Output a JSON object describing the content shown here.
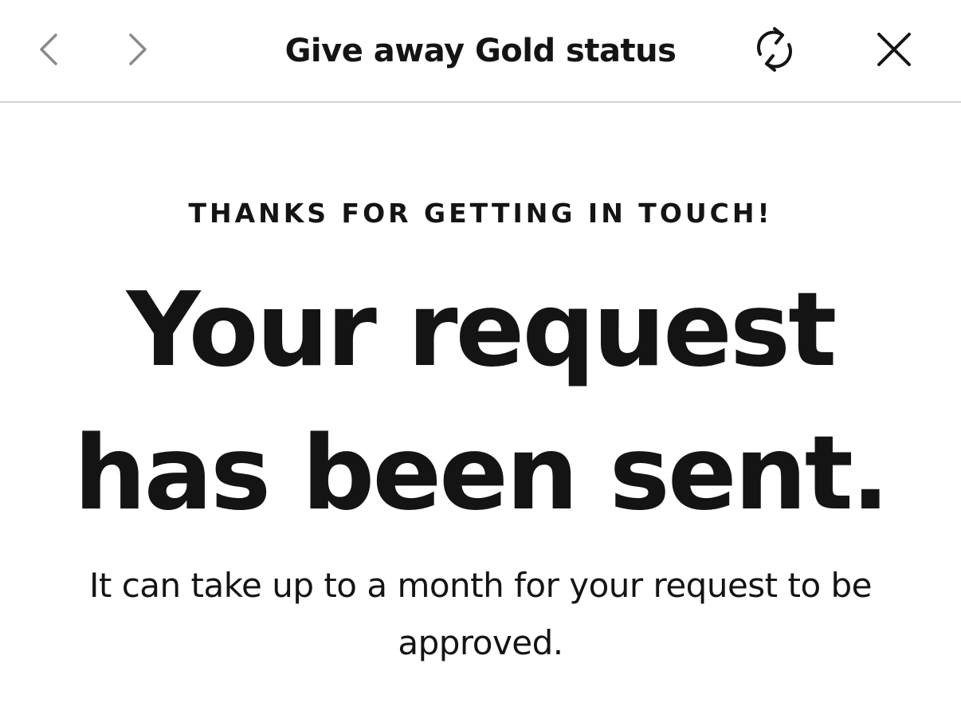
{
  "header": {
    "title": "Give away Gold status",
    "back_icon": "chevron-left-icon",
    "forward_icon": "chevron-right-icon",
    "refresh_icon": "refresh-icon",
    "close_icon": "close-icon"
  },
  "main": {
    "eyebrow": "THANKS FOR GETTING IN TOUCH!",
    "headline_line1": "Your request",
    "headline_line2": "has been sent.",
    "body": "It can take up to a month for your request to be approved."
  },
  "colors": {
    "text": "#141414",
    "nav_disabled": "#8a8a8a",
    "divider": "#d4d4d4",
    "background": "#ffffff"
  }
}
